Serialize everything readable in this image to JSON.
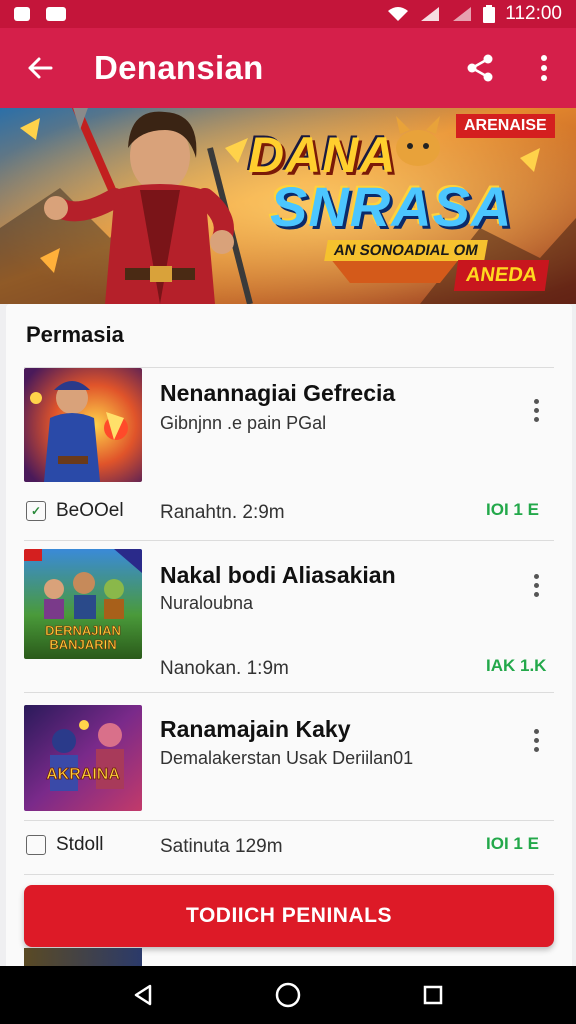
{
  "status_bar": {
    "time": "112:00"
  },
  "app_bar": {
    "title": "Denansian"
  },
  "banner": {
    "title_line1": "DANA",
    "title_line2": "SNRASA",
    "subtitle": "AN SONOADIAL OM",
    "tag_top": "ARENAISE",
    "tag_bottom": "ANEDA"
  },
  "section": {
    "title": "Permasia"
  },
  "items": [
    {
      "title": "Nenannagiai Gefrecia",
      "subtitle": "Gibnjnn .e pain PGal",
      "time": "Ranahtn. 2:9m",
      "count": "IOI 1 E",
      "source": "BeOOel",
      "source_icon": "chat-icon"
    },
    {
      "title": "Nakal bodi Aliasakian",
      "subtitle": "Nuraloubna",
      "time": "Nanokan. 1:9m",
      "count": "IAK 1.K",
      "thumb_text_line1": "DERNAJIAN",
      "thumb_text_line2": "BANJARIN"
    },
    {
      "title": "Ranamajain Kaky",
      "subtitle": "Demalakerstan Usak Deriilan01",
      "time": "Satinuta 129m",
      "count": "IOI 1 E",
      "source": "Stdoll",
      "source_icon": "document-icon",
      "thumb_text": "AKRAINA"
    }
  ],
  "cta": {
    "label": "TODIICH PENINALS"
  },
  "colors": {
    "primary": "#d51f4a",
    "status_bar": "#c4153a",
    "cta": "#dd1a27",
    "count_green": "#23a84a"
  }
}
